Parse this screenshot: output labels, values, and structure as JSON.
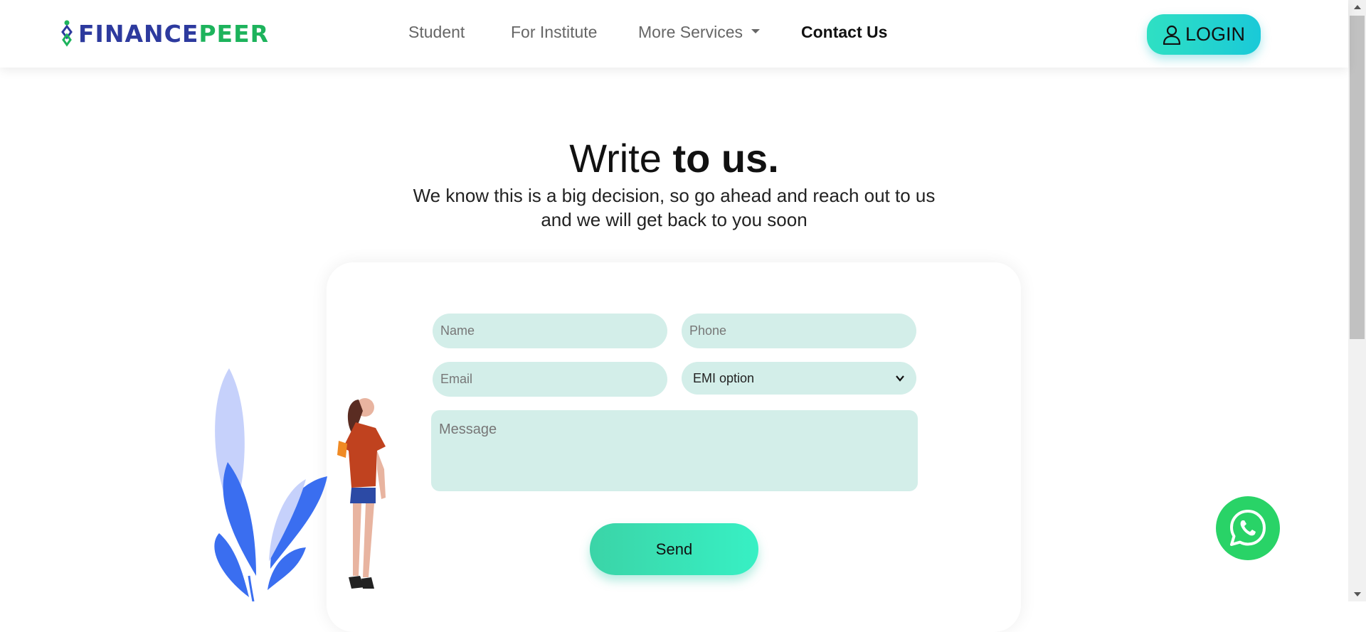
{
  "brand": {
    "part1": "FINANCE",
    "part2": "PEER",
    "primary_color": "#2d3a9e",
    "secondary_color": "#1db35c"
  },
  "nav": {
    "items": [
      {
        "label": "Student"
      },
      {
        "label": "For Institute"
      },
      {
        "label": "More Services"
      },
      {
        "label": "Contact Us"
      }
    ],
    "login_label": "LOGIN",
    "login_icon": "user-icon"
  },
  "hero": {
    "title_light": "Write ",
    "title_bold": "to us.",
    "subtitle": "We know this is a big decision, so go ahead and reach out to us and we will get back to you soon"
  },
  "form": {
    "name_placeholder": "Name",
    "phone_placeholder": "Phone",
    "email_placeholder": "Email",
    "emi_selected": "EMI option",
    "message_placeholder": "Message",
    "send_label": "Send",
    "field_color": "#d3eee9",
    "accent_color": "#37f0c4"
  },
  "whatsapp": {
    "icon": "whatsapp-icon",
    "color": "#29d367"
  }
}
